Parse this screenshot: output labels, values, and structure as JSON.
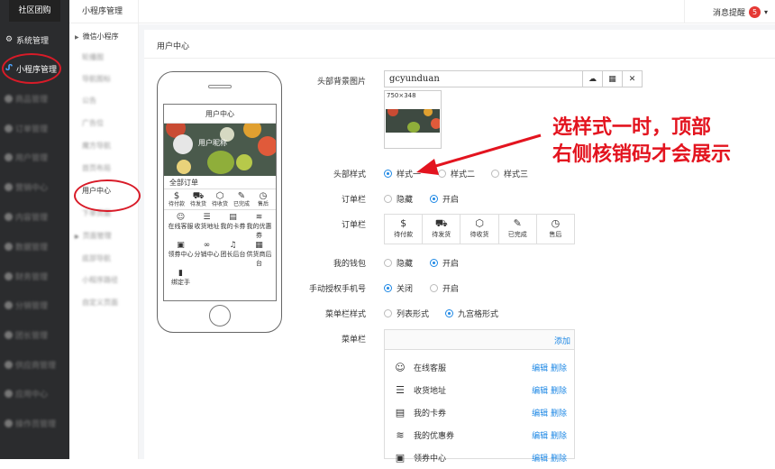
{
  "sidebar": {
    "brand": "社区团购",
    "items": [
      {
        "label": "系统管理",
        "icon": "gear-icon"
      },
      {
        "label": "小程序管理",
        "icon": "miniprogram-icon"
      },
      {
        "label": "商品管理"
      },
      {
        "label": "订单管理"
      },
      {
        "label": "用户管理"
      },
      {
        "label": "营销中心"
      },
      {
        "label": "内容管理"
      },
      {
        "label": "数据管理"
      },
      {
        "label": "财务管理"
      },
      {
        "label": "分销管理"
      },
      {
        "label": "团长管理"
      },
      {
        "label": "供应商管理"
      },
      {
        "label": "应用中心"
      },
      {
        "label": "操作员管理"
      }
    ]
  },
  "subnav": {
    "title": "小程序管理",
    "group1": "微信小程序",
    "items": [
      "轮播图",
      "导航图标",
      "公告",
      "广告位",
      "魔方导航",
      "首页布局",
      "用户中心",
      "下单页面"
    ],
    "group2": "页面管理",
    "items2": [
      "底部导航",
      "小程序路径",
      "自定义页面"
    ]
  },
  "topbar": {
    "msg_label": "消息提醒",
    "msg_count": "5",
    "caret": "▾"
  },
  "page": {
    "title": "用户中心"
  },
  "phone": {
    "header": "用户中心",
    "username": "用户昵称",
    "order_title": "全部订单",
    "order_items": [
      {
        "label": "待付款",
        "icon": "dollar-icon"
      },
      {
        "label": "待发货",
        "icon": "truck-icon"
      },
      {
        "label": "待收货",
        "icon": "box-icon"
      },
      {
        "label": "已完成",
        "icon": "pin-icon"
      },
      {
        "label": "售后",
        "icon": "history-icon"
      }
    ],
    "grid_items": [
      {
        "label": "在线客服",
        "icon": "smile-icon"
      },
      {
        "label": "收货地址",
        "icon": "list-icon"
      },
      {
        "label": "我的卡券",
        "icon": "card-icon"
      },
      {
        "label": "我的优惠券",
        "icon": "coins-icon"
      },
      {
        "label": "领券中心",
        "icon": "coupon-icon"
      },
      {
        "label": "分销中心",
        "icon": "link-icon"
      },
      {
        "label": "团长后台",
        "icon": "bell-icon"
      },
      {
        "label": "供货商后台",
        "icon": "doc-icon"
      },
      {
        "label": "绑定手",
        "icon": "phone-icon"
      }
    ]
  },
  "form": {
    "bg_label": "头部背景图片",
    "bg_value": "gcyunduan",
    "bg_size": "750×348",
    "header_style_label": "头部样式",
    "header_styles": [
      "样式一",
      "样式二",
      "样式三"
    ],
    "order_bar_label": "订单栏",
    "order_bar_options": [
      "隐藏",
      "开启"
    ],
    "order_bar2_label": "订单栏",
    "wallet_label": "我的钱包",
    "wallet_options": [
      "隐藏",
      "开启"
    ],
    "phone_auth_label": "手动授权手机号",
    "phone_auth_options": [
      "关闭",
      "开启"
    ],
    "menu_style_label": "菜单栏样式",
    "menu_style_options": [
      "列表形式",
      "九宫格形式"
    ],
    "menu_label": "菜单栏",
    "menu_add": "添加",
    "menu_rows": [
      {
        "label": "在线客服",
        "icon": "smile-icon",
        "ops": "编辑 删除"
      },
      {
        "label": "收货地址",
        "icon": "list-icon",
        "ops": "编辑 删除"
      },
      {
        "label": "我的卡券",
        "icon": "card-icon",
        "ops": "编辑 删除"
      },
      {
        "label": "我的优惠券",
        "icon": "coins-icon",
        "ops": "编辑 删除"
      },
      {
        "label": "领券中心",
        "icon": "coupon-icon",
        "ops": "编辑 删除"
      }
    ]
  },
  "annotation": {
    "line1": "选样式一时，顶部",
    "line2": "右侧核销码才会展示",
    "color": "#e3141f"
  }
}
